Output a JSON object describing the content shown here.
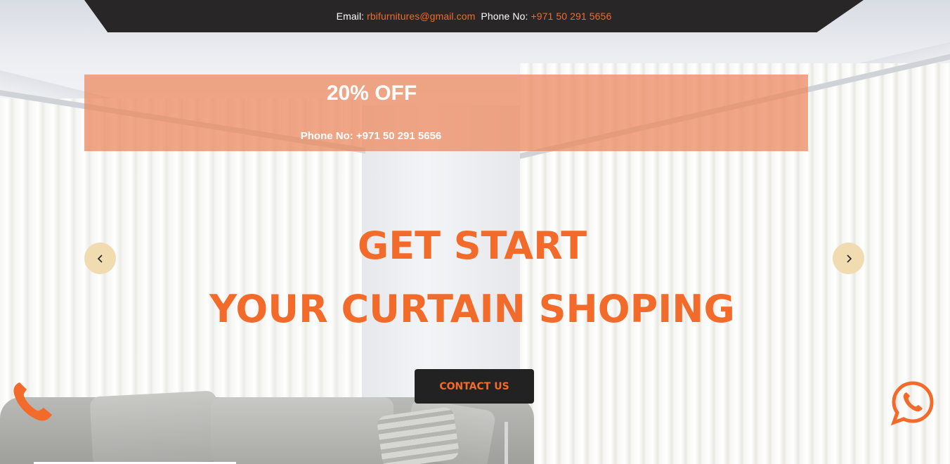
{
  "topbar": {
    "email_label": "Email:",
    "email_value": "rbifurnitures@gmail.com",
    "phone_label": "Phone No:",
    "phone_value": "+971 50 291 5656"
  },
  "promo": {
    "title": "20% OFF",
    "phone": "Phone No: +971 50 291 5656"
  },
  "hero": {
    "line1": "GET START",
    "line2": "YOUR CURTAIN SHOPING",
    "cta_label": "CONTACT US"
  },
  "carousel": {
    "prev_icon": "chevron-left-icon",
    "next_icon": "chevron-right-icon"
  },
  "floating": {
    "call_icon": "phone-icon",
    "whatsapp_icon": "whatsapp-icon"
  },
  "colors": {
    "accent": "#f26b2a",
    "topbar_bg": "#282626",
    "promo_bg": "#ec8a5f",
    "cta_bg": "#222222",
    "arrow_bg": "#f1dcb1"
  }
}
